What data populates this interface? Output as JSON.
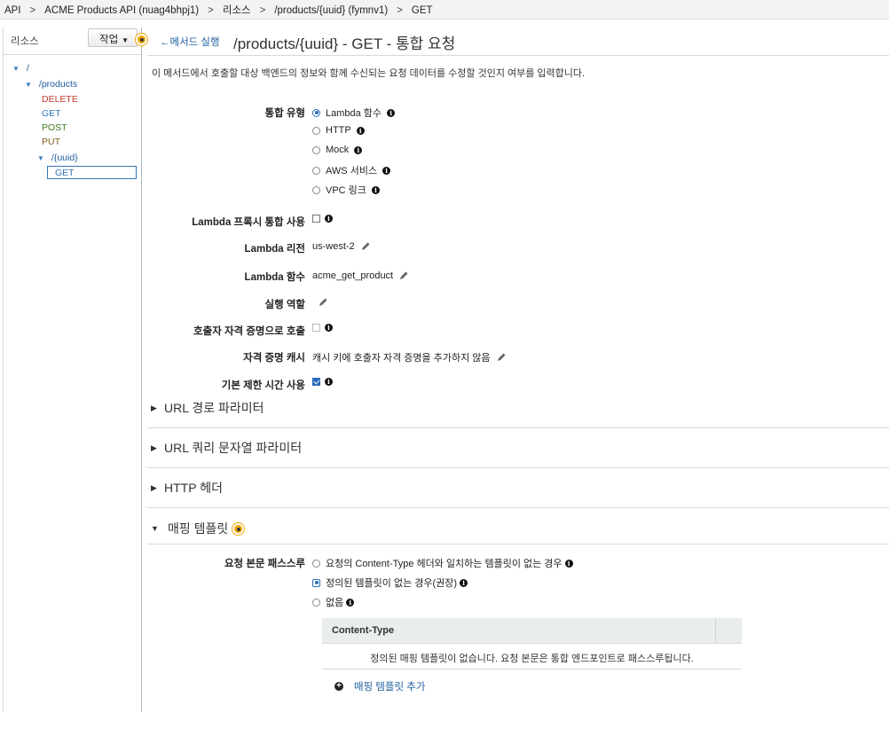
{
  "breadcrumb": [
    "API",
    "ACME Products API (nuag4bhpj1)",
    "리소스",
    "/products/{uuid} (fymnv1)",
    "GET"
  ],
  "breadcrumb_sep": ">",
  "sidebar": {
    "title": "리소스",
    "action_label": "작업",
    "tree": {
      "root": "/",
      "products": "/products",
      "methods": [
        "DELETE",
        "GET",
        "POST",
        "PUT"
      ],
      "uuid": "/{uuid}",
      "uuid_method": "GET"
    }
  },
  "header": {
    "back_label": "메서드 실행",
    "title": "/products/{uuid} - GET - 통합 요청"
  },
  "description": "이 메서드에서 호출할 대상 백엔드의 정보와 함께 수신되는 요청 데이터를 수정할 것인지 여부를 입력합니다.",
  "integration": {
    "type_label": "통합 유형",
    "types": [
      "Lambda 함수",
      "HTTP",
      "Mock",
      "AWS 서비스",
      "VPC 링크"
    ],
    "selected_type": "Lambda 함수",
    "proxy_label": "Lambda 프록시 통합 사용",
    "proxy_checked": false,
    "region_label": "Lambda 리전",
    "region_value": "us-west-2",
    "function_label": "Lambda 함수",
    "function_value": "acme_get_product",
    "role_label": "실행 역할",
    "role_value": "",
    "caller_cred_label": "호출자 자격 증명으로 호출",
    "caller_cred_checked": false,
    "cache_label": "자격 증명 캐시",
    "cache_value": "캐시 키에 호출자 자격 증명을 추가하지 않음",
    "timeout_label": "기본 제한 시간 사용",
    "timeout_checked": true
  },
  "sections": {
    "url_path": "URL 경로 파라미터",
    "url_query": "URL 쿼리 문자열 파라미터",
    "http_headers": "HTTP 헤더",
    "mapping": "매핑 템플릿"
  },
  "mapping": {
    "passthrough_label": "요청 본문 패스스루",
    "options": [
      "요청의 Content-Type 헤더와 일치하는 템플릿이 없는 경우",
      "정의된 템플릿이 없는 경우(권장)",
      "없음"
    ],
    "selected_option": 1,
    "table_header": "Content-Type",
    "table_empty": "정의된 매핑 템플릿이 없습니다. 요청 본문은 통합 엔드포인트로 패스스루됩니다.",
    "add_label": "매핑 템플릿 추가"
  },
  "colors": {
    "link": "#1f5f9e",
    "accent_dot": "#f0a500",
    "radio_selected": "#2b6cb8"
  }
}
